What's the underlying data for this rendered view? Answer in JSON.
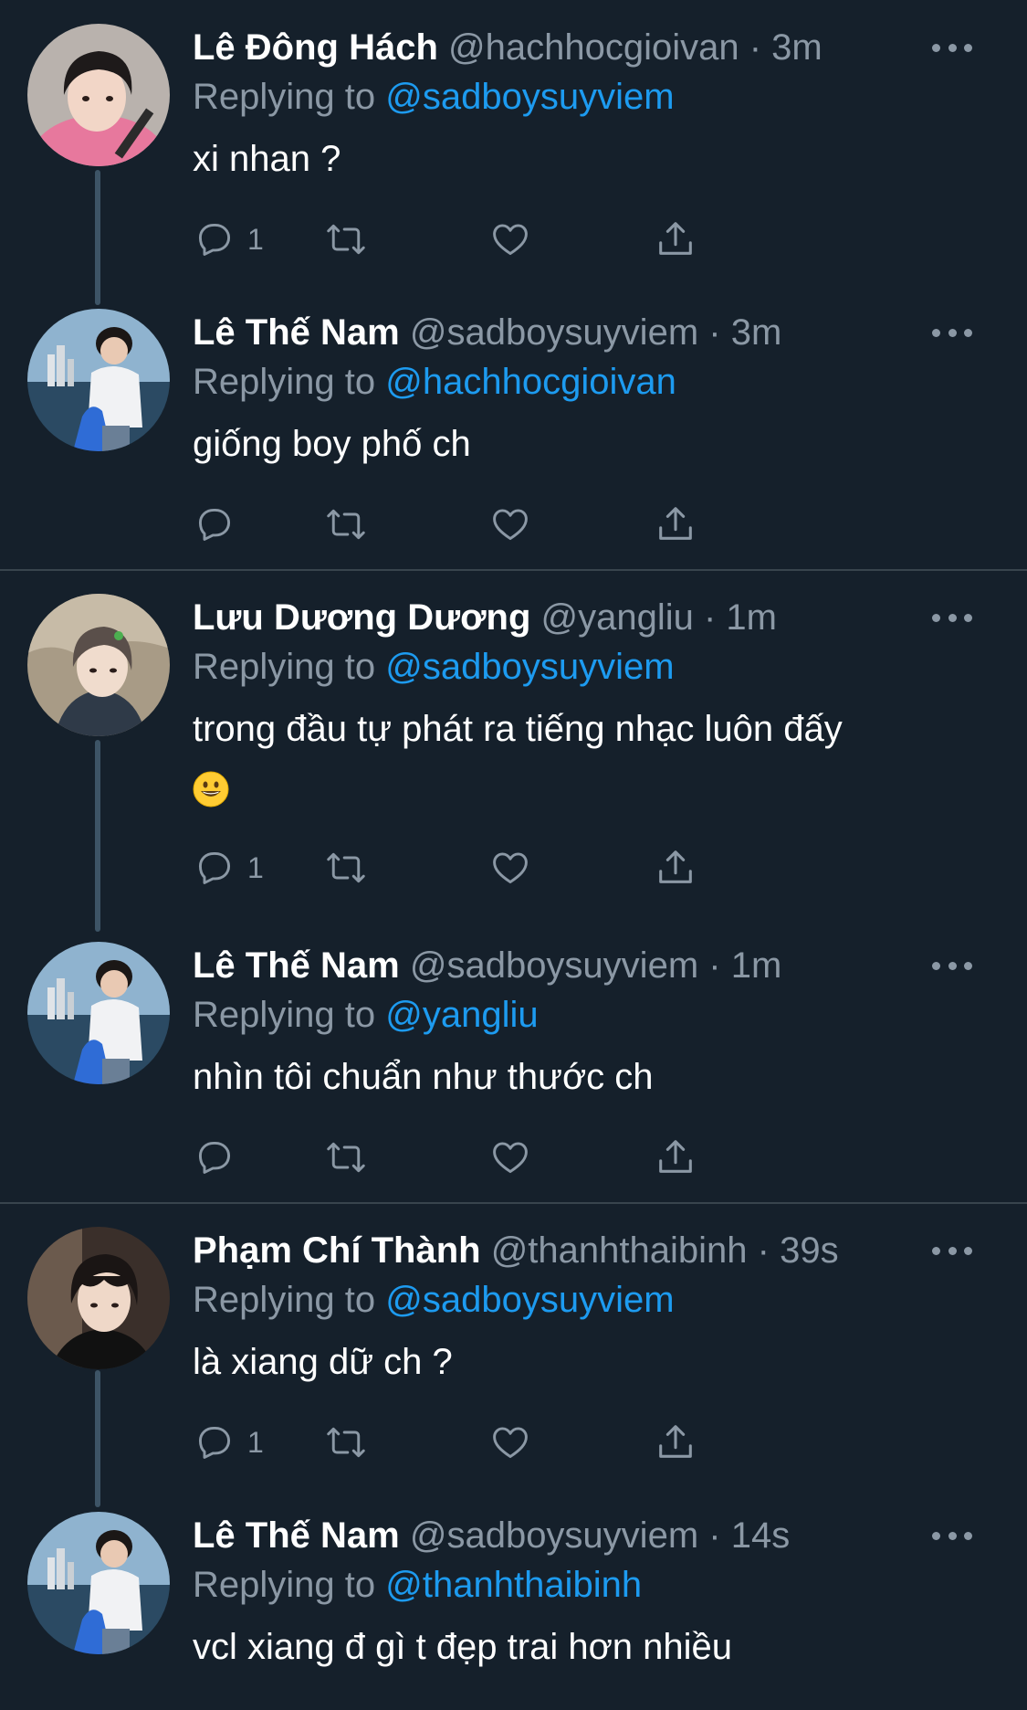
{
  "colors": {
    "background": "#15202b",
    "text_primary": "#ffffff",
    "text_secondary": "#8b98a5",
    "link": "#1d9bf0",
    "divider": "#38444d",
    "thread_line": "#3d5466"
  },
  "replying_prefix": "Replying to",
  "tweets": [
    {
      "name": "Lê Đông Hách",
      "handle": "@hachhocgioivan",
      "time": "· 3m",
      "replying_to": "@sadboysuyviem",
      "text": "xi nhan ?",
      "reply_count": "1",
      "avatar": "avatar-pink-hoodie"
    },
    {
      "name": "Lê Thế Nam",
      "handle": "@sadboysuyviem",
      "time": "· 3m",
      "replying_to": "@hachhocgioivan",
      "text": "giống boy phố ch",
      "reply_count": "",
      "avatar": "avatar-seaside"
    },
    {
      "name": "Lưu Dương Dương",
      "handle": "@yangliu",
      "time": "· 1m",
      "replying_to": "@sadboysuyviem",
      "text": "trong đầu tự phát ra tiếng nhạc luôn đấy",
      "emoji": "grinning-face-emoji",
      "reply_count": "1",
      "avatar": "avatar-outdoor"
    },
    {
      "name": "Lê Thế Nam",
      "handle": "@sadboysuyviem",
      "time": "· 1m",
      "replying_to": "@yangliu",
      "text": "nhìn tôi chuẩn như thước ch",
      "reply_count": "",
      "avatar": "avatar-seaside"
    },
    {
      "name": "Phạm Chí Thành",
      "handle": "@thanhthaibinh",
      "time": "· 39s",
      "replying_to": "@sadboysuyviem",
      "text": "là xiang dữ ch ?",
      "reply_count": "1",
      "avatar": "avatar-dark"
    },
    {
      "name": "Lê Thế Nam",
      "handle": "@sadboysuyviem",
      "time": "· 14s",
      "replying_to": "@thanhthaibinh",
      "text": "vcl xiang đ gì t đẹp trai hơn nhiều",
      "reply_count": "",
      "avatar": "avatar-seaside"
    }
  ]
}
